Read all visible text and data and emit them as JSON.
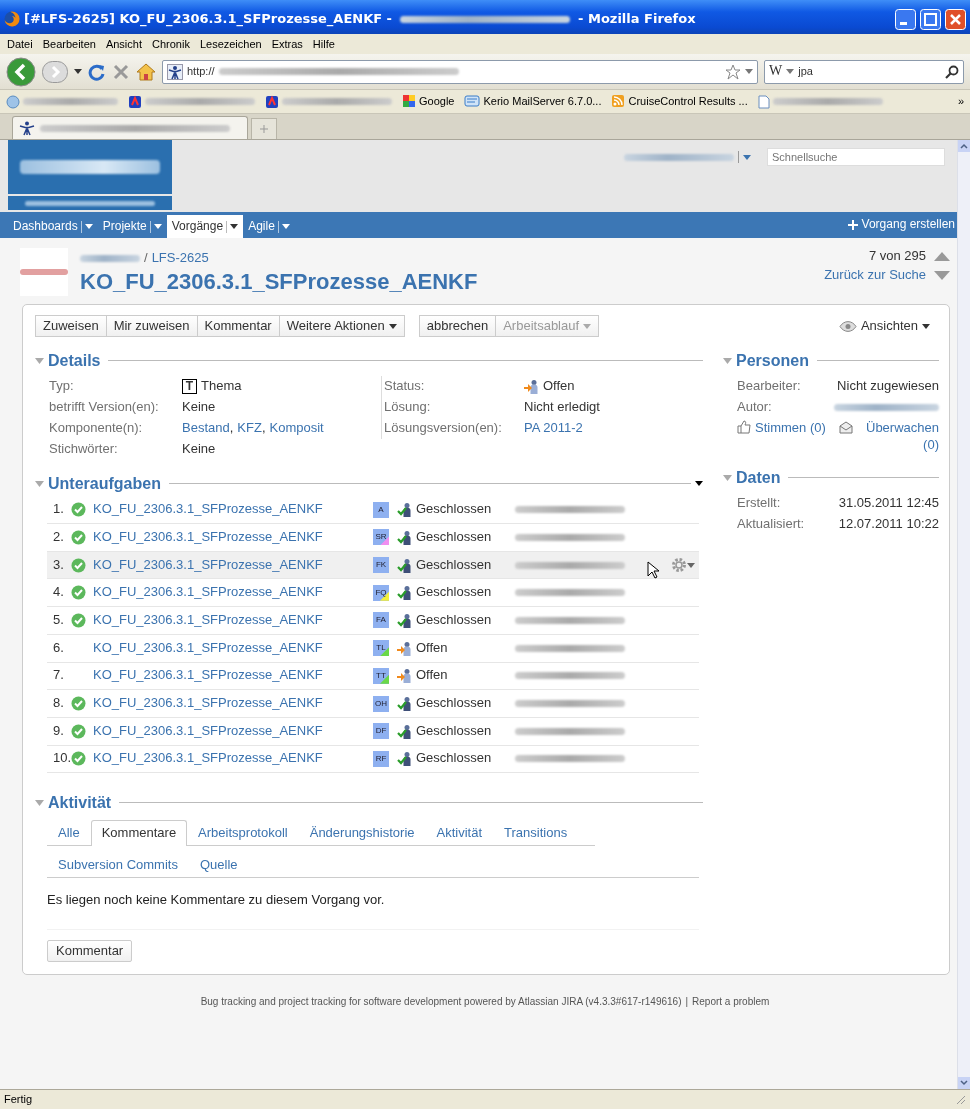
{
  "window": {
    "title_start": "[#LFS-2625] KO_FU_2306.3.1_SFProzesse_AENKF -",
    "title_end": "- Mozilla Firefox"
  },
  "menu": [
    "Datei",
    "Bearbeiten",
    "Ansicht",
    "Chronik",
    "Lesezeichen",
    "Extras",
    "Hilfe"
  ],
  "address_bar": {
    "url_prefix": "http://"
  },
  "search_bar": {
    "engine": "W",
    "value": "jpa"
  },
  "bookmarks": [
    {
      "kind": "redacted"
    },
    {
      "kind": "redacted"
    },
    {
      "kind": "redacted"
    },
    {
      "kind": "link",
      "label": "Google"
    },
    {
      "kind": "link",
      "label": "Kerio MailServer 6.7.0..."
    },
    {
      "kind": "link",
      "label": "CruiseControl Results ..."
    },
    {
      "kind": "redacted"
    }
  ],
  "bookmarks_overflow": "»",
  "header": {
    "quick_search_placeholder": "Schnellsuche"
  },
  "nav": [
    {
      "label": "Dashboards",
      "selected": false
    },
    {
      "label": "Projekte",
      "selected": false
    },
    {
      "label": "Vorgänge",
      "selected": true
    },
    {
      "label": "Agile",
      "selected": false
    }
  ],
  "create_button": "Vorgang erstellen",
  "issue": {
    "separator": "/",
    "key": "LFS-2625",
    "title": "KO_FU_2306.3.1_SFProzesse_AENKF",
    "pager": "7 von 295",
    "back_link": "Zurück zur Suche"
  },
  "toolbar_groups": [
    [
      {
        "label": "Zuweisen",
        "dropdown": false,
        "disabled": false
      },
      {
        "label": "Mir zuweisen",
        "dropdown": false,
        "disabled": false
      },
      {
        "label": "Kommentar",
        "dropdown": false,
        "disabled": false
      },
      {
        "label": "Weitere Aktionen",
        "dropdown": true,
        "disabled": false
      }
    ],
    [
      {
        "label": "abbrechen",
        "dropdown": false,
        "disabled": false
      },
      {
        "label": "Arbeitsablauf",
        "dropdown": true,
        "disabled": true
      }
    ]
  ],
  "views_button": "Ansichten",
  "details": {
    "heading": "Details",
    "left": [
      {
        "label": "Typ:",
        "kind": "type",
        "icon": "T",
        "value": "Thema"
      },
      {
        "label": "betrifft Version(en):",
        "kind": "text",
        "value": "Keine"
      },
      {
        "label": "Komponente(n):",
        "kind": "links",
        "links": [
          "Bestand",
          "KFZ",
          "Komposit"
        ],
        "separator": ","
      },
      {
        "label": "Stichwörter:",
        "kind": "text",
        "value": "Keine"
      }
    ],
    "right": [
      {
        "label": "Status:",
        "kind": "status",
        "closed": false,
        "value": "Offen"
      },
      {
        "label": "Lösung:",
        "kind": "text",
        "value": "Nicht erledigt"
      },
      {
        "label": "Lösungsversion(en):",
        "kind": "links",
        "links": [
          "PA 2011-2"
        ]
      }
    ]
  },
  "people": {
    "heading": "Personen",
    "rows": [
      {
        "label": "Bearbeiter:",
        "kind": "text",
        "value": "Nicht zugewiesen"
      },
      {
        "label": "Autor:",
        "kind": "redacted"
      }
    ],
    "votes": "Stimmen (0)",
    "watchers": "Überwachen (0)"
  },
  "dates": {
    "heading": "Daten",
    "rows": [
      {
        "label": "Erstellt:",
        "value": "31.05.2011 12:45"
      },
      {
        "label": "Aktualisiert:",
        "value": "12.07.2011 10:22"
      }
    ]
  },
  "subtasks": {
    "heading": "Unteraufgaben",
    "rows": [
      {
        "number": "1.",
        "resolved": true,
        "summary": "KO_FU_2306.3.1_SFProzesse_AENKF",
        "type": "A",
        "color": "#8eb0f0",
        "closed": true,
        "status": "Geschlossen",
        "selected": false
      },
      {
        "number": "2.",
        "resolved": true,
        "summary": "KO_FU_2306.3.1_SFProzesse_AENKF",
        "type": "SR",
        "color": "#f08ef0",
        "closed": true,
        "status": "Geschlossen",
        "selected": false
      },
      {
        "number": "3.",
        "resolved": true,
        "summary": "KO_FU_2306.3.1_SFProzesse_AENKF",
        "type": "FK",
        "color": "#8eb0f0",
        "closed": true,
        "status": "Geschlossen",
        "selected": true
      },
      {
        "number": "4.",
        "resolved": true,
        "summary": "KO_FU_2306.3.1_SFProzesse_AENKF",
        "type": "FQ",
        "color": "#f4f03c",
        "closed": true,
        "status": "Geschlossen",
        "selected": false
      },
      {
        "number": "5.",
        "resolved": true,
        "summary": "KO_FU_2306.3.1_SFProzesse_AENKF",
        "type": "FA",
        "color": "#8eb0f0",
        "closed": true,
        "status": "Geschlossen",
        "selected": false
      },
      {
        "number": "6.",
        "resolved": false,
        "summary": "KO_FU_2306.3.1_SFProzesse_AENKF",
        "type": "TL",
        "color": "#6ad848",
        "closed": false,
        "status": "Offen",
        "selected": false
      },
      {
        "number": "7.",
        "resolved": false,
        "summary": "KO_FU_2306.3.1_SFProzesse_AENKF",
        "type": "TT",
        "color": "#6ad848",
        "closed": false,
        "status": "Offen",
        "selected": false
      },
      {
        "number": "8.",
        "resolved": true,
        "summary": "KO_FU_2306.3.1_SFProzesse_AENKF",
        "type": "OH",
        "color": "#8eb0f0",
        "closed": true,
        "status": "Geschlossen",
        "selected": false
      },
      {
        "number": "9.",
        "resolved": true,
        "summary": "KO_FU_2306.3.1_SFProzesse_AENKF",
        "type": "DF",
        "color": "#8eb0f0",
        "closed": true,
        "status": "Geschlossen",
        "selected": false
      },
      {
        "number": "10.",
        "resolved": true,
        "summary": "KO_FU_2306.3.1_SFProzesse_AENKF",
        "type": "RF",
        "color": "#8eb0f0",
        "closed": true,
        "status": "Geschlossen",
        "selected": false
      }
    ]
  },
  "activity": {
    "heading": "Aktivität",
    "tab_rows": [
      [
        {
          "label": "Alle",
          "selected": false
        },
        {
          "label": "Kommentare",
          "selected": true
        },
        {
          "label": "Arbeitsprotokoll",
          "selected": false
        },
        {
          "label": "Änderungshistorie",
          "selected": false
        },
        {
          "label": "Aktivität",
          "selected": false
        },
        {
          "label": "Transitions",
          "selected": false
        }
      ],
      [
        {
          "label": "Subversion Commits",
          "selected": false
        },
        {
          "label": "Quelle",
          "selected": false
        }
      ]
    ],
    "message": "Es liegen noch keine Kommentare zu diesem Vorgang vor.",
    "comment_button": "Kommentar"
  },
  "footer": {
    "text": "Bug tracking and project tracking for software development powered by Atlassian JIRA (v4.3.3#617-r149616)",
    "separator": "|",
    "link": "Report a problem"
  },
  "status_bar": "Fertig"
}
